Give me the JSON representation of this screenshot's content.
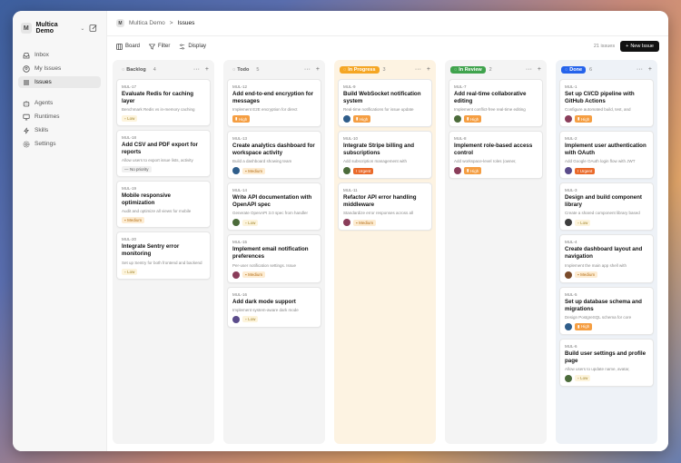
{
  "sidebar": {
    "workspace_badge": "M",
    "workspace_name": "Multica Demo",
    "items": [
      {
        "label": "Inbox",
        "icon": "inbox-icon"
      },
      {
        "label": "My Issues",
        "icon": "user-circle-icon"
      },
      {
        "label": "Issues",
        "icon": "list-icon"
      },
      {
        "label": "Agents",
        "icon": "bot-icon"
      },
      {
        "label": "Runtimes",
        "icon": "monitor-icon"
      },
      {
        "label": "Skills",
        "icon": "lightning-icon"
      },
      {
        "label": "Settings",
        "icon": "gear-icon"
      }
    ]
  },
  "breadcrumb": {
    "workspace": "Multica Demo",
    "separator": ">",
    "current": "Issues"
  },
  "toolbar": {
    "board": "Board",
    "filter": "Filter",
    "display": "Display",
    "count": "21 issues",
    "new_issue": "New Issue"
  },
  "colors": {
    "high": "#f59e42",
    "urgent": "#ea6a2a",
    "medium": "#e8a23a",
    "low": "#e0b24a",
    "in_progress": "#f5a623",
    "in_review": "#3fa34d",
    "done": "#2563eb"
  },
  "columns": [
    {
      "name": "Backlog",
      "count": "4",
      "bg": "#f4f4f4",
      "pill_bg": "transparent",
      "pill_color": "#555",
      "cards": [
        {
          "id": "MUL-17",
          "title": "Evaluate Redis for caching layer",
          "desc": "Benchmark Redis vs in-memory caching",
          "priority": "Low",
          "avatar": false
        },
        {
          "id": "MUL-18",
          "title": "Add CSV and PDF export for reports",
          "desc": "Allow users to export issue lists, activity",
          "priority": "No priority",
          "avatar": false
        },
        {
          "id": "MUL-19",
          "title": "Mobile responsive optimization",
          "desc": "Audit and optimize all views for mobile",
          "priority": "Medium",
          "avatar": false
        },
        {
          "id": "MUL-20",
          "title": "Integrate Sentry error monitoring",
          "desc": "Set up Sentry for both frontend and backend",
          "priority": "Low",
          "avatar": false
        }
      ]
    },
    {
      "name": "Todo",
      "count": "5",
      "bg": "#f4f4f4",
      "pill_bg": "transparent",
      "pill_color": "#555",
      "cards": [
        {
          "id": "MUL-12",
          "title": "Add end-to-end encryption for messages",
          "desc": "Implement E2E encryption for direct",
          "priority": "High",
          "avatar": false
        },
        {
          "id": "MUL-13",
          "title": "Create analytics dashboard for workspace activity",
          "desc": "Build a dashboard showing team",
          "priority": "Medium",
          "avatar": true
        },
        {
          "id": "MUL-14",
          "title": "Write API documentation with OpenAPI spec",
          "desc": "Generate OpenAPI 3.0 spec from handler",
          "priority": "Low",
          "avatar": true
        },
        {
          "id": "MUL-15",
          "title": "Implement email notification preferences",
          "desc": "Per-user notification settings. Issue",
          "priority": "Medium",
          "avatar": true
        },
        {
          "id": "MUL-16",
          "title": "Add dark mode support",
          "desc": "Implement system-aware dark mode",
          "priority": "Low",
          "avatar": true
        }
      ]
    },
    {
      "name": "In Progress",
      "count": "3",
      "bg": "#fdf3e2",
      "pill_bg": "#f5a623",
      "pill_color": "#fff",
      "cards": [
        {
          "id": "MUL-9",
          "title": "Build WebSocket notification system",
          "desc": "Real-time notifications for issue update",
          "priority": "High",
          "avatar": true
        },
        {
          "id": "MUL-10",
          "title": "Integrate Stripe billing and subscriptions",
          "desc": "Add subscription management with",
          "priority": "Urgent",
          "avatar": true
        },
        {
          "id": "MUL-11",
          "title": "Refactor API error handling middleware",
          "desc": "Standardize error responses across all",
          "priority": "Medium",
          "avatar": true
        }
      ]
    },
    {
      "name": "In Review",
      "count": "2",
      "bg": "#f4f4f4",
      "pill_bg": "#3fa34d",
      "pill_color": "#fff",
      "cards": [
        {
          "id": "MUL-7",
          "title": "Add real-time collaborative editing",
          "desc": "Implement conflict-free real-time editing",
          "priority": "High",
          "avatar": true
        },
        {
          "id": "MUL-8",
          "title": "Implement role-based access control",
          "desc": "Add workspace-level roles (owner,",
          "priority": "High",
          "avatar": true
        }
      ]
    },
    {
      "name": "Done",
      "count": "6",
      "bg": "#eef2f7",
      "pill_bg": "#2563eb",
      "pill_color": "#fff",
      "cards": [
        {
          "id": "MUL-1",
          "title": "Set up CI/CD pipeline with GitHub Actions",
          "desc": "Configure automated build, test, and",
          "priority": "High",
          "avatar": true
        },
        {
          "id": "MUL-2",
          "title": "Implement user authentication with OAuth",
          "desc": "Add Google OAuth login flow with JWT",
          "priority": "Urgent",
          "avatar": true
        },
        {
          "id": "MUL-3",
          "title": "Design and build component library",
          "desc": "Create a shared component library based",
          "priority": "Low",
          "avatar": true
        },
        {
          "id": "MUL-4",
          "title": "Create dashboard layout and navigation",
          "desc": "Implement the main app shell with",
          "priority": "Medium",
          "avatar": true
        },
        {
          "id": "MUL-5",
          "title": "Set up database schema and migrations",
          "desc": "Design PostgreSQL schema for core",
          "priority": "High",
          "avatar": true
        },
        {
          "id": "MUL-6",
          "title": "Build user settings and profile page",
          "desc": "Allow users to update name, avatar,",
          "priority": "Low",
          "avatar": true
        }
      ]
    }
  ]
}
